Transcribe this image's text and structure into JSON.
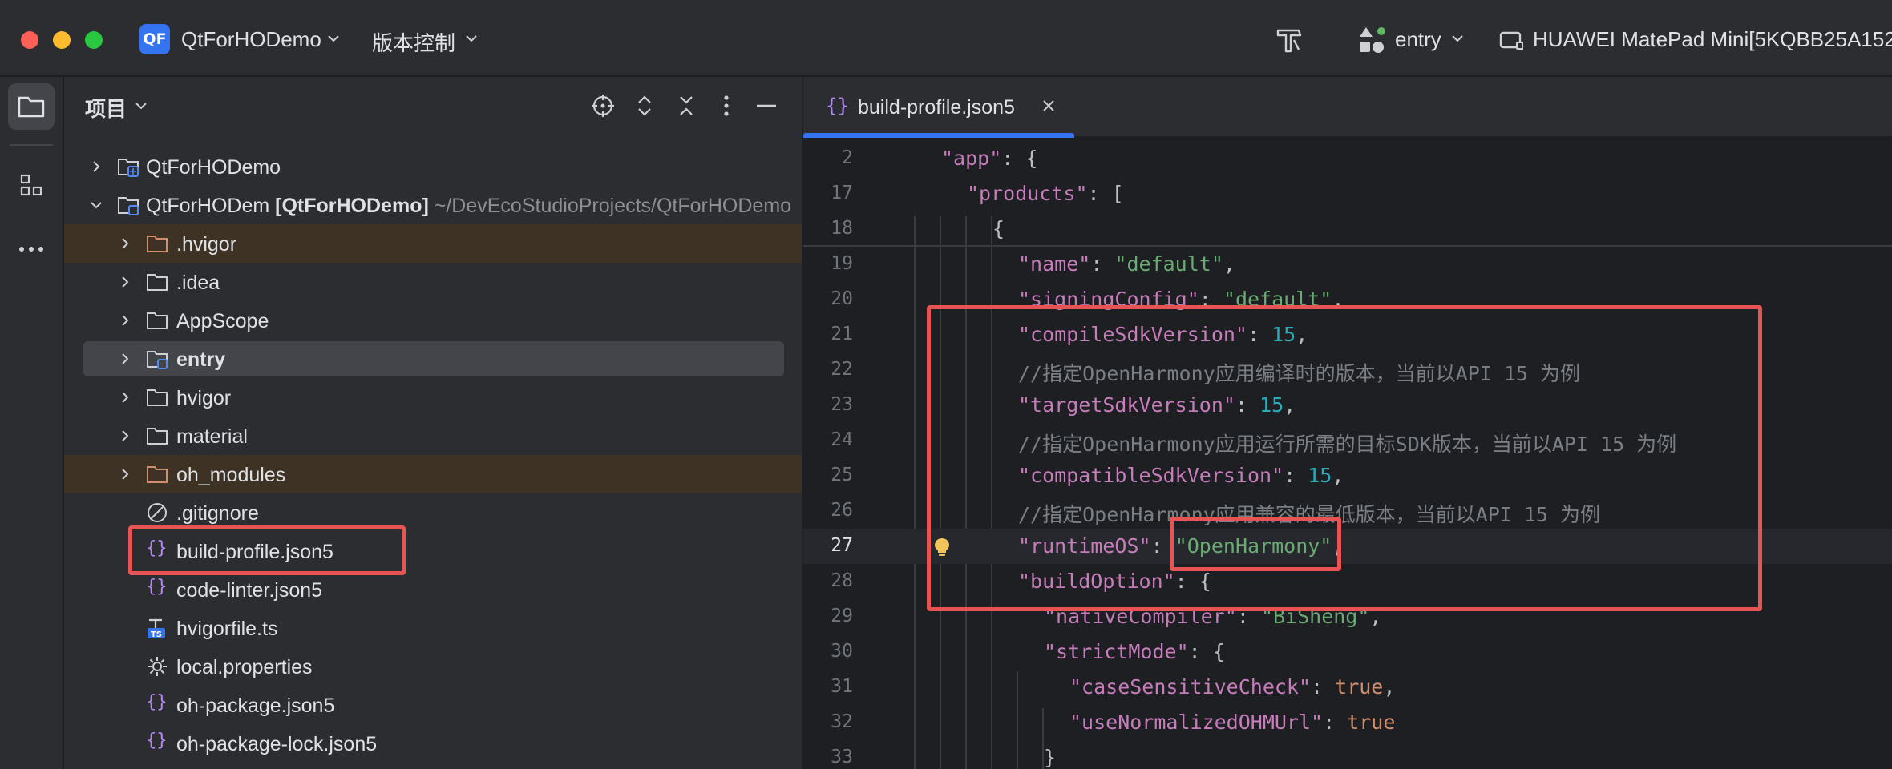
{
  "titlebar": {
    "project_badge": "QF",
    "project_name": "QtForHODemo",
    "vcs_label": "版本控制",
    "run_config": "entry",
    "device": "HUAWEI MatePad Mini[5KQBB25A152"
  },
  "project_panel": {
    "title": "项目",
    "tree": [
      {
        "label": "QtForHODemo",
        "icon": "module-icon",
        "expandable": true,
        "expanded": false
      },
      {
        "label": "QtForHODem",
        "tag": "[QtForHODemo]",
        "path": "~/DevEcoStudioProjects/QtForHODemo",
        "icon": "module-folder-icon",
        "expandable": true,
        "expanded": true
      },
      {
        "label": ".hvigor",
        "icon": "excluded-folder-icon",
        "expandable": true,
        "excluded": true
      },
      {
        "label": ".idea",
        "icon": "folder-icon",
        "expandable": true
      },
      {
        "label": "AppScope",
        "icon": "folder-icon",
        "expandable": true
      },
      {
        "label": "entry",
        "icon": "module-folder-icon",
        "expandable": true,
        "selected": true
      },
      {
        "label": "hvigor",
        "icon": "folder-icon",
        "expandable": true
      },
      {
        "label": "material",
        "icon": "folder-icon",
        "expandable": true
      },
      {
        "label": "oh_modules",
        "icon": "excluded-folder-icon",
        "expandable": true,
        "excluded": true
      },
      {
        "label": ".gitignore",
        "icon": "ignore-file-icon"
      },
      {
        "label": "build-profile.json5",
        "icon": "json-file-icon"
      },
      {
        "label": "code-linter.json5",
        "icon": "json-file-icon"
      },
      {
        "label": "hvigorfile.ts",
        "icon": "ts-file-icon"
      },
      {
        "label": "local.properties",
        "icon": "properties-file-icon"
      },
      {
        "label": "oh-package.json5",
        "icon": "json-file-icon"
      },
      {
        "label": "oh-package-lock.json5",
        "icon": "json-file-icon"
      }
    ]
  },
  "editor": {
    "tab_icon": "{}",
    "tab_label": "build-profile.json5",
    "lines": [
      {
        "n": "2",
        "tokens": [
          [
            "k",
            "\"app\""
          ],
          [
            "p",
            ": {"
          ]
        ]
      },
      {
        "n": "17",
        "tokens": [
          [
            "k",
            "\"products\""
          ],
          [
            "p",
            ": ["
          ]
        ]
      },
      {
        "n": "18",
        "tokens": [
          [
            "p",
            "{"
          ]
        ]
      },
      {
        "n": "19",
        "tokens": [
          [
            "k",
            "\"name\""
          ],
          [
            "p",
            ": "
          ],
          [
            "s",
            "\"default\""
          ],
          [
            "p",
            ","
          ]
        ]
      },
      {
        "n": "20",
        "tokens": [
          [
            "k",
            "\"signingConfig\""
          ],
          [
            "p",
            ": "
          ],
          [
            "s",
            "\"default\""
          ],
          [
            "p",
            ","
          ]
        ]
      },
      {
        "n": "21",
        "tokens": [
          [
            "k",
            "\"compileSdkVersion\""
          ],
          [
            "p",
            ": "
          ],
          [
            "n",
            "15"
          ],
          [
            "p",
            ","
          ]
        ]
      },
      {
        "n": "22",
        "tokens": [
          [
            "c",
            "//指定OpenHarmony应用编译时的版本，当前以API 15 为例"
          ]
        ]
      },
      {
        "n": "23",
        "tokens": [
          [
            "k",
            "\"targetSdkVersion\""
          ],
          [
            "p",
            ": "
          ],
          [
            "n",
            "15"
          ],
          [
            "p",
            ","
          ]
        ]
      },
      {
        "n": "24",
        "tokens": [
          [
            "c",
            "//指定OpenHarmony应用运行所需的目标SDK版本，当前以API 15 为例"
          ]
        ]
      },
      {
        "n": "25",
        "tokens": [
          [
            "k",
            "\"compatibleSdkVersion\""
          ],
          [
            "p",
            ": "
          ],
          [
            "n",
            "15"
          ],
          [
            "p",
            ","
          ]
        ]
      },
      {
        "n": "26",
        "tokens": [
          [
            "c",
            "//指定OpenHarmony应用兼容的最低版本，当前以API 15 为例"
          ]
        ]
      },
      {
        "n": "27",
        "tokens": [
          [
            "k",
            "\"runtimeOS\""
          ],
          [
            "p",
            ": "
          ],
          [
            "s",
            "\"OpenHarmony\""
          ],
          [
            "p",
            ","
          ]
        ]
      },
      {
        "n": "28",
        "tokens": [
          [
            "k",
            "\"buildOption\""
          ],
          [
            "p",
            ": {"
          ]
        ]
      },
      {
        "n": "29",
        "tokens": [
          [
            "k",
            "\"nativeCompiler\""
          ],
          [
            "p",
            ": "
          ],
          [
            "s",
            "\"BiSheng\""
          ],
          [
            "p",
            ","
          ]
        ]
      },
      {
        "n": "30",
        "tokens": [
          [
            "k",
            "\"strictMode\""
          ],
          [
            "p",
            ": {"
          ]
        ]
      },
      {
        "n": "31",
        "tokens": [
          [
            "k",
            "\"caseSensitiveCheck\""
          ],
          [
            "p",
            ": "
          ],
          [
            "b",
            "true"
          ],
          [
            "p",
            ","
          ]
        ]
      },
      {
        "n": "32",
        "tokens": [
          [
            "k",
            "\"useNormalizedOHMUrl\""
          ],
          [
            "p",
            ": "
          ],
          [
            "b",
            "true"
          ]
        ]
      },
      {
        "n": "33",
        "tokens": [
          [
            "p",
            "}"
          ]
        ]
      }
    ]
  },
  "colors": {
    "accent": "#3574f0",
    "annotation": "#e85454",
    "excluded_folder": "#cf8e6d",
    "json_icon": "#b189f5"
  }
}
